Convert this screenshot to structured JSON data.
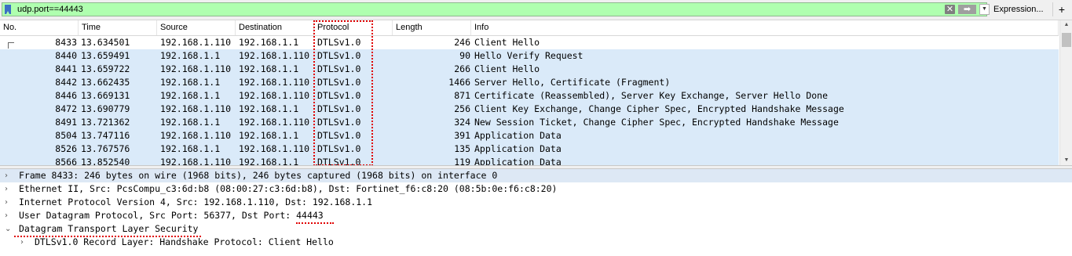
{
  "filter": {
    "value": "udp.port==44443",
    "expression_label": "Expression...",
    "add_label": "+",
    "clear_glyph": "✕",
    "apply_glyph": "➡",
    "dropdown_glyph": "▼"
  },
  "columns": [
    "No.",
    "Time",
    "Source",
    "Destination",
    "Protocol",
    "Length",
    "Info"
  ],
  "packets": [
    {
      "no": "8433",
      "time": "13.634501",
      "src": "192.168.1.110",
      "dst": "192.168.1.1",
      "proto": "DTLSv1.0",
      "len": "246",
      "info": "Client Hello"
    },
    {
      "no": "8440",
      "time": "13.659491",
      "src": "192.168.1.1",
      "dst": "192.168.1.110",
      "proto": "DTLSv1.0",
      "len": "90",
      "info": "Hello Verify Request"
    },
    {
      "no": "8441",
      "time": "13.659722",
      "src": "192.168.1.110",
      "dst": "192.168.1.1",
      "proto": "DTLSv1.0",
      "len": "266",
      "info": "Client Hello"
    },
    {
      "no": "8442",
      "time": "13.662435",
      "src": "192.168.1.1",
      "dst": "192.168.1.110",
      "proto": "DTLSv1.0",
      "len": "1466",
      "info": "Server Hello, Certificate (Fragment)"
    },
    {
      "no": "8446",
      "time": "13.669131",
      "src": "192.168.1.1",
      "dst": "192.168.1.110",
      "proto": "DTLSv1.0",
      "len": "871",
      "info": "Certificate (Reassembled), Server Key Exchange, Server Hello Done"
    },
    {
      "no": "8472",
      "time": "13.690779",
      "src": "192.168.1.110",
      "dst": "192.168.1.1",
      "proto": "DTLSv1.0",
      "len": "256",
      "info": "Client Key Exchange, Change Cipher Spec, Encrypted Handshake Message"
    },
    {
      "no": "8491",
      "time": "13.721362",
      "src": "192.168.1.1",
      "dst": "192.168.1.110",
      "proto": "DTLSv1.0",
      "len": "324",
      "info": "New Session Ticket, Change Cipher Spec, Encrypted Handshake Message"
    },
    {
      "no": "8504",
      "time": "13.747116",
      "src": "192.168.1.110",
      "dst": "192.168.1.1",
      "proto": "DTLSv1.0",
      "len": "391",
      "info": "Application Data"
    },
    {
      "no": "8526",
      "time": "13.767576",
      "src": "192.168.1.1",
      "dst": "192.168.1.110",
      "proto": "DTLSv1.0",
      "len": "135",
      "info": "Application Data"
    },
    {
      "no": "8566",
      "time": "13.852540",
      "src": "192.168.1.110",
      "dst": "192.168.1.1",
      "proto": "DTLSv1.0",
      "len": "119",
      "info": "Application Data"
    }
  ],
  "details": [
    {
      "text": "Frame 8433: 246 bytes on wire (1968 bits), 246 bytes captured (1968 bits) on interface 0",
      "arrow": "›"
    },
    {
      "text": "Ethernet II, Src: PcsCompu_c3:6d:b8 (08:00:27:c3:6d:b8), Dst: Fortinet_f6:c8:20 (08:5b:0e:f6:c8:20)",
      "arrow": "›"
    },
    {
      "text": "Internet Protocol Version 4, Src: 192.168.1.110, Dst: 192.168.1.1",
      "arrow": "›"
    },
    {
      "text": "User Datagram Protocol, Src Port: 56377, Dst Port: 44443",
      "arrow": "›"
    },
    {
      "text": "Datagram Transport Layer Security",
      "arrow": "⌄"
    },
    {
      "text": "DTLSv1.0 Record Layer: Handshake Protocol: Client Hello",
      "arrow": "›"
    }
  ],
  "colors": {
    "filter_bg": "#afffaf",
    "row_bg": "#daeaf9",
    "annotation": "#e00000"
  },
  "icons": {
    "bookmark": "bookmark-icon",
    "clear": "clear-icon",
    "apply": "apply-arrow-icon",
    "dropdown": "chevron-down-icon"
  }
}
